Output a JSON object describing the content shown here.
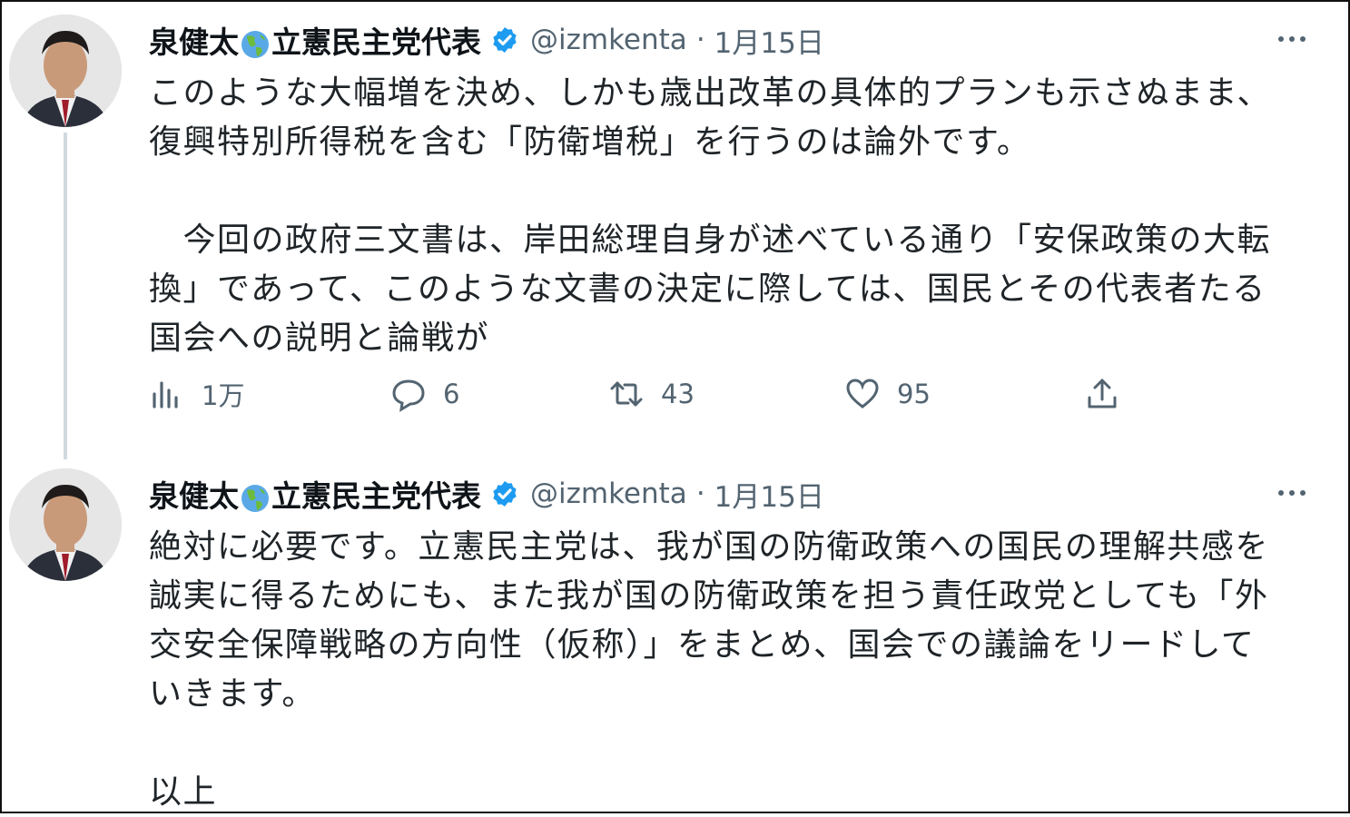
{
  "colors": {
    "verified": "#1d9bf0",
    "text_secondary": "#536471",
    "thread_line": "#cfd9de"
  },
  "tweets": [
    {
      "display_name_part1": "泉健太",
      "emoji": "globe-americas-icon",
      "display_name_part2": "立憲民主党代表",
      "handle": "@izmkenta",
      "separator": "·",
      "date": "1月15日",
      "paragraphs": [
        "このような大幅増を決め、しかも歳出改革の具体的プランも示さぬまま、",
        "復興特別所得税を含む「防衛増税」を行うのは論外です。",
        "",
        "　今回の政府三文書は、岸田総理自身が述べている通り「安保政策の大転",
        "換」であって、このような文書の決定に際しては、国民とその代表者たる",
        "国会への説明と論戦が"
      ],
      "metrics": {
        "views": "1万",
        "replies": "6",
        "retweets": "43",
        "likes": "95"
      }
    },
    {
      "display_name_part1": "泉健太",
      "emoji": "globe-americas-icon",
      "display_name_part2": "立憲民主党代表",
      "handle": "@izmkenta",
      "separator": "·",
      "date": "1月15日",
      "paragraphs": [
        "絶対に必要です。立憲民主党は、我が国の防衛政策への国民の理解共感を",
        "誠実に得るためにも、また我が国の防衛政策を担う責任政党としても「外",
        "交安全保障戦略の方向性（仮称）」をまとめ、国会での議論をリードして",
        "いきます。",
        "",
        "以上"
      ]
    }
  ]
}
